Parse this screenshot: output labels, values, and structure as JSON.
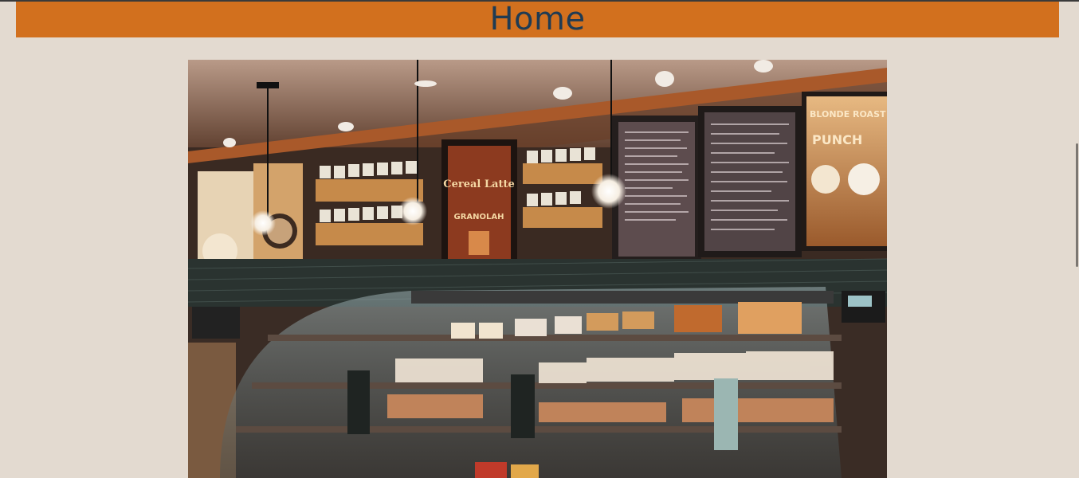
{
  "header": {
    "title": "Home"
  },
  "hero": {
    "image_alt": "Coffee shop counter with pastry display case, menu boards and pendant lights",
    "menu_boards": [
      {
        "heading": "Cereal Latte",
        "sub": "GRANOLAH"
      },
      {
        "heading": "BLONDE ROAST"
      },
      {
        "heading": "PUNCH"
      }
    ]
  },
  "colors": {
    "page_background": "#e3dad0",
    "header_background": "#d2701e",
    "header_text": "#1f3b53"
  }
}
